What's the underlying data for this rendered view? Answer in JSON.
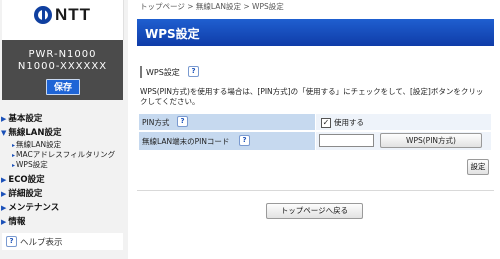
{
  "sidebar": {
    "logo_text": "NTT",
    "device_model": "PWR-N1000",
    "device_name": "N1000-XXXXXX",
    "save_label": "保存",
    "nav": {
      "basic": "基本設定",
      "wireless": "無線LAN設定",
      "wireless_sub": [
        "無線LAN設定",
        "MACアドレスフィルタリング",
        "WPS設定"
      ],
      "eco": "ECO設定",
      "advanced": "詳細設定",
      "maintenance": "メンテナンス",
      "info": "情報"
    },
    "help_label": "ヘルプ表示"
  },
  "breadcrumb": "トップページ > 無線LAN設定 > WPS設定",
  "page_title": "WPS設定",
  "section": {
    "title": "WPS設定",
    "description": "WPS(PIN方式)を使用する場合は、[PIN方式]の「使用する」にチェックをして、[設定]ボタンをクリックしてください。"
  },
  "settings": {
    "pin_method_label": "PIN方式",
    "pin_method_checkbox_label": "使用する",
    "pin_method_checked": true,
    "pin_code_label": "無線LAN端末のPINコード",
    "pin_code_value": "",
    "wps_pin_button": "WPS(PIN方式)"
  },
  "buttons": {
    "set": "設定",
    "back_to_top": "トップページへ戻る"
  },
  "colors": {
    "title_banner": "#1a50c8",
    "device_box": "#4b4b4b",
    "save_button": "#1e64d6",
    "row_label_bg": "#c6d9ef"
  }
}
